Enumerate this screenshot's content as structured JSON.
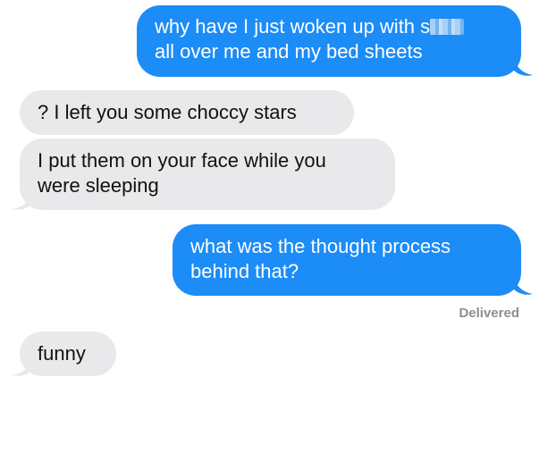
{
  "conversation": {
    "messages": [
      {
        "direction": "sent",
        "text": "why have I just woken up with s\nall over me and my bed sheets"
      },
      {
        "direction": "received",
        "text": "? I left you some choccy stars"
      },
      {
        "direction": "received",
        "text": "I put them on your face while you\nwere sleeping"
      },
      {
        "direction": "sent",
        "text": "what was the thought process\nbehind that?"
      },
      {
        "direction": "received",
        "text": "funny"
      }
    ],
    "delivery_status": "Delivered"
  },
  "colors": {
    "sent_bubble": "#1c8cf7",
    "received_bubble": "#e9e9eb",
    "status_text": "#8e8e93"
  }
}
